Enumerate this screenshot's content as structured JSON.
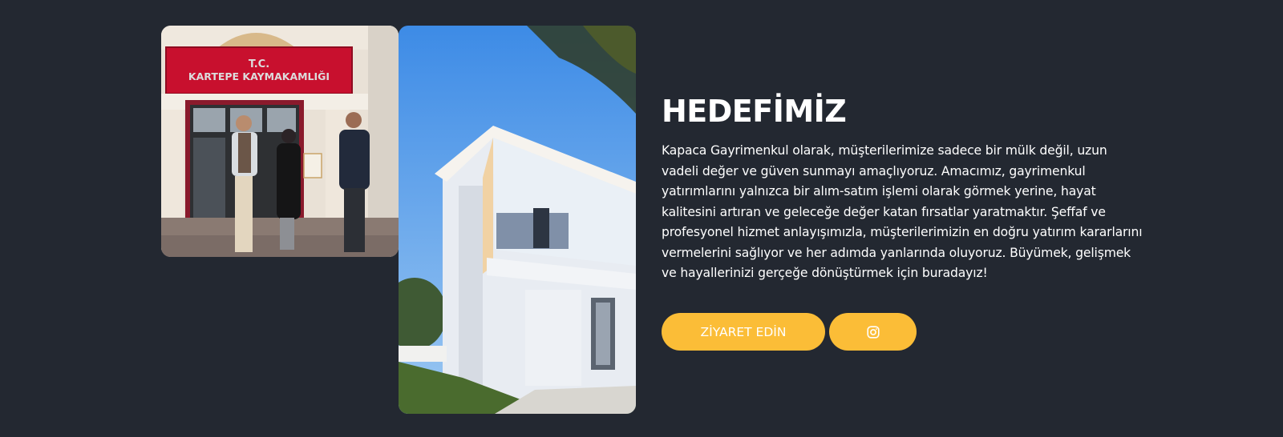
{
  "section": {
    "title": "HEDEFİMİZ",
    "description": "Kapaca Gayrimenkul olarak, müşterilerimize sadece bir mülk değil, uzun vadeli değer ve güven sunmayı amaçlıyoruz. Amacımız, gayrimenkul yatırımlarını yalnızca bir alım-satım işlemi olarak görmek yerine, hayat kalitesini artıran ve geleceğe değer katan fırsatlar yaratmaktır. Şeffaf ve profesyonel hizmet anlayışımızla, müşterilerimizin en doğru yatırım kararlarını vermelerini sağlıyor ve her adımda yanlarında oluyoruz. Büyümek, gelişmek ve hayallerinizi gerçeğe dönüştürmek için buradayız!"
  },
  "photos": {
    "office_sign_line1": "T.C.",
    "office_sign_line2": "KARTEPE KAYMAKAMLIĞI"
  },
  "buttons": {
    "visit_label": "ZİYARET EDİN",
    "instagram_icon": "instagram-icon"
  },
  "colors": {
    "background": "#232831",
    "accent": "#fbbd37",
    "text": "#ffffff"
  }
}
